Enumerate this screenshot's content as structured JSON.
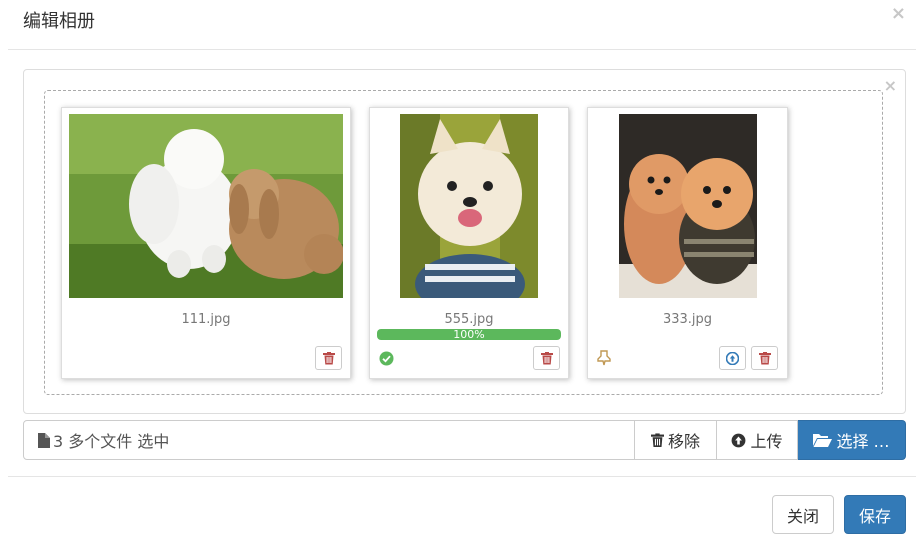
{
  "modal": {
    "title": "编辑相册",
    "close_glyph": "×"
  },
  "preview": {
    "close_glyph": "×",
    "files": [
      {
        "name": "111.jpg",
        "image": "puppy and rabbit on grass",
        "status": "none",
        "actions": [
          "delete"
        ]
      },
      {
        "name": "555.jpg",
        "image": "white pomeranian in striped shirt",
        "status": "success",
        "progress": "100%",
        "actions": [
          "delete"
        ]
      },
      {
        "name": "333.jpg",
        "image": "two pomeranian dogs",
        "status": "pending",
        "actions": [
          "upload",
          "delete"
        ]
      }
    ]
  },
  "input_group": {
    "caption": "3 多个文件 选中",
    "remove_label": "移除",
    "upload_label": "上传",
    "browse_label": "选择 …"
  },
  "footer": {
    "close_label": "关闭",
    "save_label": "保存"
  },
  "colors": {
    "primary": "#337ab7",
    "success": "#5cb85c",
    "danger": "#b94a48",
    "border": "#cccccc"
  }
}
